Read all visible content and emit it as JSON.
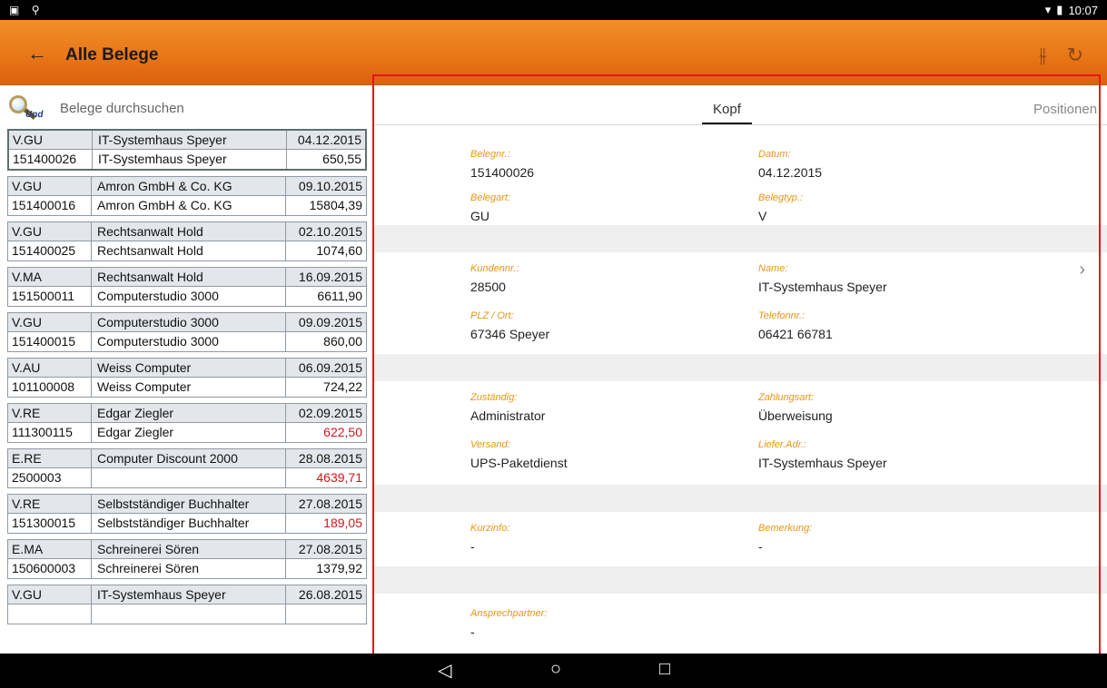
{
  "status": {
    "time": "10:07"
  },
  "appbar": {
    "title": "Alle Belege",
    "back_icon": "arrow-left",
    "filter_icon": "sliders",
    "refresh_icon": "refresh"
  },
  "search": {
    "placeholder": "Belege durchsuchen",
    "badge": "Und"
  },
  "list": [
    {
      "type": "V.GU",
      "nr": "151400026",
      "name1": "IT-Systemhaus Speyer",
      "name2": "IT-Systemhaus Speyer",
      "date": "04.12.2015",
      "amount": "650,55",
      "neg": false
    },
    {
      "type": "V.GU",
      "nr": "151400016",
      "name1": "Amron GmbH & Co. KG",
      "name2": "Amron GmbH & Co. KG",
      "date": "09.10.2015",
      "amount": "15804,39",
      "neg": false
    },
    {
      "type": "V.GU",
      "nr": "151400025",
      "name1": "Rechtsanwalt Hold",
      "name2": "Rechtsanwalt Hold",
      "date": "02.10.2015",
      "amount": "1074,60",
      "neg": false
    },
    {
      "type": "V.MA",
      "nr": "151500011",
      "name1": "Rechtsanwalt Hold",
      "name2": "Computerstudio 3000",
      "date": "16.09.2015",
      "amount": "6611,90",
      "neg": false
    },
    {
      "type": "V.GU",
      "nr": "151400015",
      "name1": "Computerstudio 3000",
      "name2": "Computerstudio 3000",
      "date": "09.09.2015",
      "amount": "860,00",
      "neg": false
    },
    {
      "type": "V.AU",
      "nr": "101100008",
      "name1": "Weiss Computer",
      "name2": "Weiss Computer",
      "date": "06.09.2015",
      "amount": "724,22",
      "neg": false
    },
    {
      "type": "V.RE",
      "nr": "111300115",
      "name1": "Edgar Ziegler",
      "name2": "Edgar Ziegler",
      "date": "02.09.2015",
      "amount": "622,50",
      "neg": true
    },
    {
      "type": "E.RE",
      "nr": "2500003",
      "name1": "Computer Discount 2000",
      "name2": "",
      "date": "28.08.2015",
      "amount": "4639,71",
      "neg": true
    },
    {
      "type": "V.RE",
      "nr": "151300015",
      "name1": "Selbstständiger Buchhalter",
      "name2": "Selbstständiger Buchhalter",
      "date": "27.08.2015",
      "amount": "189,05",
      "neg": true
    },
    {
      "type": "E.MA",
      "nr": "150600003",
      "name1": "Schreinerei Sören",
      "name2": "Schreinerei Sören",
      "date": "27.08.2015",
      "amount": "1379,92",
      "neg": false
    },
    {
      "type": "V.GU",
      "nr": "",
      "name1": "IT-Systemhaus Speyer",
      "name2": "",
      "date": "26.08.2015",
      "amount": "",
      "neg": false
    }
  ],
  "tabs": {
    "kopf": "Kopf",
    "positionen": "Positionen"
  },
  "detail": {
    "belegnr_label": "Belegnr.:",
    "belegnr": "151400026",
    "datum_label": "Datum:",
    "datum": "04.12.2015",
    "belegart_label": "Belegart:",
    "belegart": "GU",
    "belegtyp_label": "Belegtyp.:",
    "belegtyp": "V",
    "kundennr_label": "Kundennr.:",
    "kundennr": "28500",
    "name_label": "Name:",
    "name": "IT-Systemhaus Speyer",
    "plz_label": "PLZ / Ort:",
    "plz": "67346 Speyer",
    "telefon_label": "Telefonnr.:",
    "telefon": "06421 66781",
    "zustaendig_label": "Zuständig:",
    "zustaendig": "Administrator",
    "zahlungsart_label": "Zahlungsart:",
    "zahlungsart": "Überweisung",
    "versand_label": "Versand:",
    "versand": "UPS-Paketdienst",
    "lieferadr_label": "Liefer.Adr.:",
    "lieferadr": "IT-Systemhaus Speyer",
    "kurzinfo_label": "Kurzinfo:",
    "kurzinfo": "-",
    "bemerkung_label": "Bemerkung:",
    "bemerkung": "-",
    "ansprech_label": "Ansprechpartner:",
    "ansprech": "-"
  },
  "colors": {
    "accent": "#e87416",
    "label": "#e89516",
    "negative": "#d0161a",
    "highlight": "#e8141b"
  }
}
